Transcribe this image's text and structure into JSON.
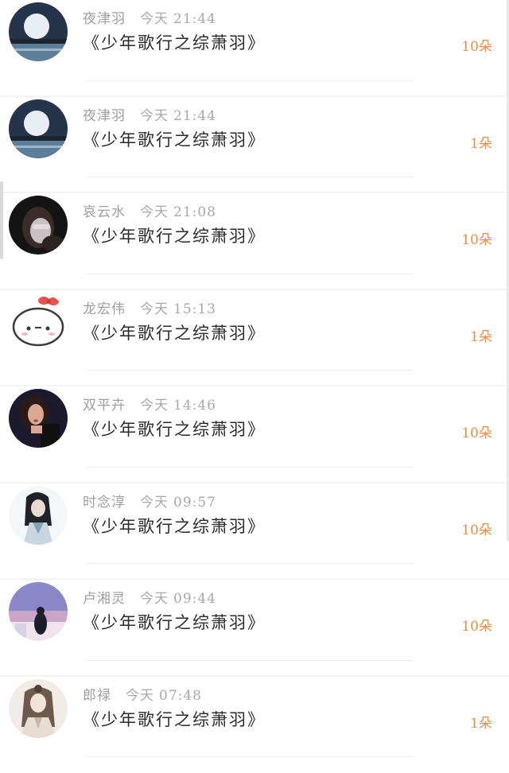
{
  "colors": {
    "gift_accent": "#f08a3c",
    "meta_gray": "#a8a8a8",
    "title_dark": "#2a2a2a"
  },
  "items": [
    {
      "name": "夜津羽",
      "day": "今天",
      "time": "21:44",
      "title": "《少年歌行之综萧羽》",
      "gift": "10朵",
      "avatar": "moon-night-avatar"
    },
    {
      "name": "夜津羽",
      "day": "今天",
      "time": "21:44",
      "title": "《少年歌行之综萧羽》",
      "gift": "1朵",
      "avatar": "moon-night-avatar"
    },
    {
      "name": "哀云水",
      "day": "今天",
      "time": "21:08",
      "title": "《少年歌行之综萧羽》",
      "gift": "10朵",
      "avatar": "girl-face-cover-avatar"
    },
    {
      "name": "龙宏伟",
      "day": "今天",
      "time": "15:13",
      "title": "《少年歌行之综萧羽》",
      "gift": "1朵",
      "avatar": "cartoon-bun-avatar"
    },
    {
      "name": "双平卉",
      "day": "今天",
      "time": "14:46",
      "title": "《少年歌行之综萧羽》",
      "gift": "10朵",
      "avatar": "woman-portrait-avatar"
    },
    {
      "name": "时念淳",
      "day": "今天",
      "time": "09:57",
      "title": "《少年歌行之综萧羽》",
      "gift": "10朵",
      "avatar": "ancient-hero-avatar"
    },
    {
      "name": "卢湘灵",
      "day": "今天",
      "time": "09:44",
      "title": "《少年歌行之综萧羽》",
      "gift": "10朵",
      "avatar": "purple-sunset-avatar"
    },
    {
      "name": "郎禄",
      "day": "今天",
      "time": "07:48",
      "title": "《少年歌行之综萧羽》",
      "gift": "1朵",
      "avatar": "ancient-scholar-avatar"
    }
  ]
}
